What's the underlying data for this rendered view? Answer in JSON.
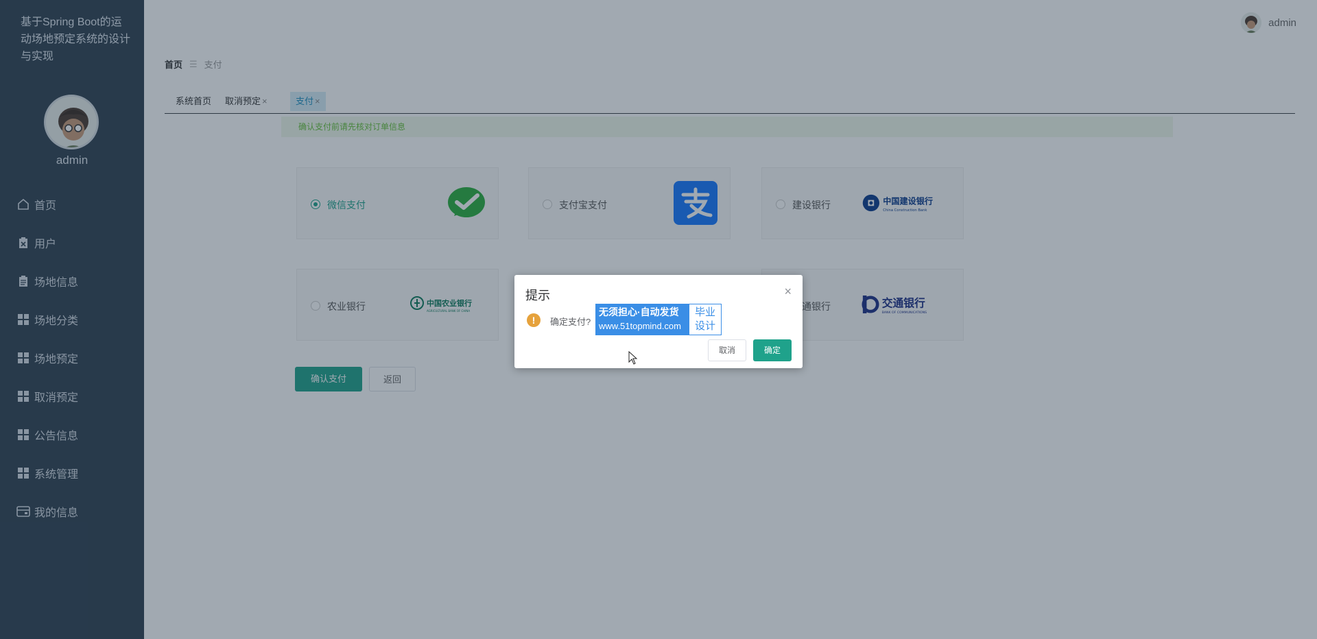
{
  "sidebar": {
    "app_title": "基于Spring Boot的运动场地预定系统的设计与实现",
    "user_name": "admin",
    "items": [
      {
        "label": "首页",
        "icon": "home-icon"
      },
      {
        "label": "用户",
        "icon": "clipboard-x-icon"
      },
      {
        "label": "场地信息",
        "icon": "clipboard-icon"
      },
      {
        "label": "场地分类",
        "icon": "grid-icon"
      },
      {
        "label": "场地预定",
        "icon": "grid-icon"
      },
      {
        "label": "取消预定",
        "icon": "grid-icon"
      },
      {
        "label": "公告信息",
        "icon": "grid-icon"
      },
      {
        "label": "系统管理",
        "icon": "grid-icon"
      },
      {
        "label": "我的信息",
        "icon": "card-icon"
      }
    ]
  },
  "topbar": {
    "user_name": "admin"
  },
  "breadcrumb": {
    "home": "首页",
    "separator": "☰",
    "current": "支付"
  },
  "tabs": [
    {
      "label": "系统首页",
      "closable": false,
      "active": false
    },
    {
      "label": "取消预定",
      "closable": true,
      "active": false
    },
    {
      "label": "支付",
      "closable": true,
      "active": true
    }
  ],
  "tab_close_glyph": "×",
  "notice": "确认支付前请先核对订单信息",
  "payment_methods": [
    {
      "label": "微信支付",
      "checked": true,
      "logo": "wechat-pay-logo"
    },
    {
      "label": "支付宝支付",
      "checked": false,
      "logo": "alipay-logo"
    },
    {
      "label": "建设银行",
      "checked": false,
      "logo": "ccb-logo",
      "logo_text": "中国建设银行",
      "logo_sub": "China Construction Bank"
    },
    {
      "label": "农业银行",
      "checked": false,
      "logo": "abc-logo",
      "logo_text": "中国农业银行",
      "logo_sub": "AGRICULTURAL BANK OF CHINA"
    },
    {
      "label": "交通银行",
      "checked": false,
      "logo": "bocom-logo",
      "logo_text": "交通银行",
      "logo_sub": "BANK OF COMMUNICATIONS"
    }
  ],
  "actions": {
    "confirm": "确认支付",
    "back": "返回"
  },
  "dialog": {
    "title": "提示",
    "close_glyph": "×",
    "warn_glyph": "!",
    "message": "确定支付?",
    "cancel": "取消",
    "ok": "确定"
  },
  "watermark": {
    "line1": "无须担心·自动发货",
    "line2": "www.51topmind.com",
    "right_line1": "毕业",
    "right_line2": "设计"
  },
  "colors": {
    "sidebar_bg": "#2f4050",
    "primary": "#1fa28b",
    "warning": "#e6a23c",
    "notice_text": "#67c23a"
  }
}
